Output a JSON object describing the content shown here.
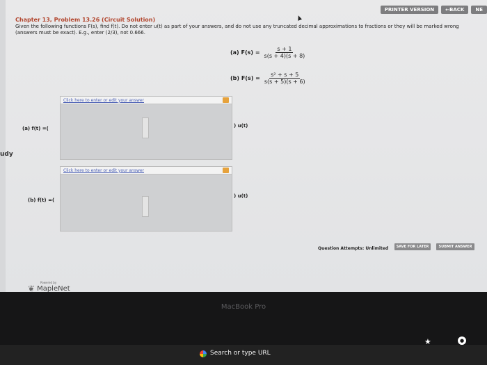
{
  "top": {
    "printer_version": "PRINTER VERSION",
    "back": "←BACK",
    "next": "NE"
  },
  "question": {
    "chapter": "Chapter 13, Problem 13.26 (Circuit Solution)",
    "instructions": "Given the following functions F(s), find f(t). Do not enter u(t) as part of your answers, and do not use any truncated decimal approximations to fractions or they will be marked wrong (answers must be exact). E.g., enter (2/3), not 0.666.",
    "eq_a_label": "(a)  F(s) =",
    "eq_a_num": "s + 1",
    "eq_a_den": "s(s + 4)(s + 8)",
    "eq_b_label": "(b)  F(s) =",
    "eq_b_num": "s² + s + 5",
    "eq_b_den": "s(s + 5)(s + 6)"
  },
  "answers": {
    "a_prefix": "(a) f(t) =(",
    "a_suffix": ") u(t)",
    "b_prefix": "(b) f(t) =(",
    "b_suffix": ") u(t)",
    "link_text": "Click here to enter or edit your answer"
  },
  "side_text": "udy",
  "footer": {
    "attempts": "Question Attempts: Unlimited",
    "save_later": "SAVE FOR LATER",
    "submit": "SUBMIT ANSWER",
    "powered_by": "Powered by",
    "brand": "MapleNet"
  },
  "device": {
    "macbook": "MacBook Pro",
    "search_placeholder": "Search or type URL"
  }
}
